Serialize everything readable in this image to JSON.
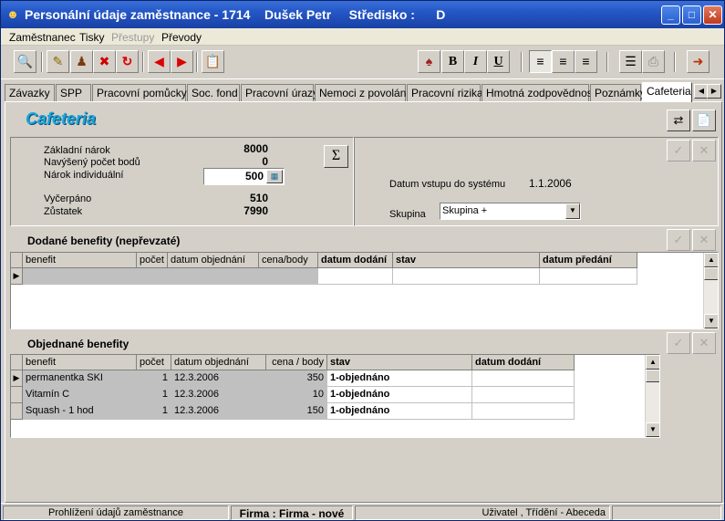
{
  "window": {
    "title": "Personální údaje zaměstnance - 1714    Dušek Petr     Středisko :      D"
  },
  "menu": {
    "items": [
      {
        "label": "Zaměstnanec"
      },
      {
        "label": "Tisky"
      },
      {
        "label": "Přestupy"
      },
      {
        "label": "Převody"
      }
    ]
  },
  "toolbar": {
    "format_bold": "B",
    "format_italic": "I",
    "format_underline": "U"
  },
  "tabs": [
    {
      "label": "Závazky"
    },
    {
      "label": "SPP"
    },
    {
      "label": "Pracovní pomůcky"
    },
    {
      "label": "Soc. fond"
    },
    {
      "label": "Pracovní úrazy"
    },
    {
      "label": "Nemoci z povolání"
    },
    {
      "label": "Pracovní rizika"
    },
    {
      "label": "Hmotná zodpovědnost"
    },
    {
      "label": "Poznámky"
    },
    {
      "label": "Cafeteria"
    }
  ],
  "section": {
    "title": "Cafeteria"
  },
  "summary": {
    "zakladni_narok_label": "Základní nárok",
    "zakladni_narok_value": "8000",
    "navyseny_label": "Navýšený počet bodů",
    "navyseny_value": "0",
    "narok_individualni_label": "Nárok individuální",
    "narok_individualni_value": "500",
    "vycerpano_label": "Vyčerpáno",
    "vycerpano_value": "510",
    "zustatek_label": "Zůstatek",
    "zustatek_value": "7990",
    "sum_symbol": "Σ",
    "datum_vstupu_label": "Datum vstupu do systému",
    "datum_vstupu_value": "1.1.2006",
    "skupina_label": "Skupina",
    "skupina_value": "Skupina +"
  },
  "dodane": {
    "title": "Dodané benefity (nepřevzaté)",
    "columns": [
      "benefit",
      "počet",
      "datum objednání",
      "cena/body",
      "datum dodání",
      "stav",
      "datum předání"
    ]
  },
  "objednane": {
    "title": "Objednané benefity",
    "columns": [
      "benefit",
      "počet",
      "datum objednání",
      "cena / body",
      "stav",
      "datum dodání"
    ],
    "rows": [
      {
        "benefit": "permanentka SKI",
        "pocet": "1",
        "datum": "12.3.2006",
        "cena": "350",
        "stav": "1-objednáno",
        "dodani": ""
      },
      {
        "benefit": "Vitamín C",
        "pocet": "1",
        "datum": "12.3.2006",
        "cena": "10",
        "stav": "1-objednáno",
        "dodani": ""
      },
      {
        "benefit": "Squash - 1 hod",
        "pocet": "1",
        "datum": "12.3.2006",
        "cena": "150",
        "stav": "1-objednáno",
        "dodani": ""
      }
    ]
  },
  "status": {
    "left": "Prohlížení údajů zaměstnance",
    "firma": "Firma :  Firma - nové",
    "right": "Uživatel , Třídění - Abeceda"
  }
}
